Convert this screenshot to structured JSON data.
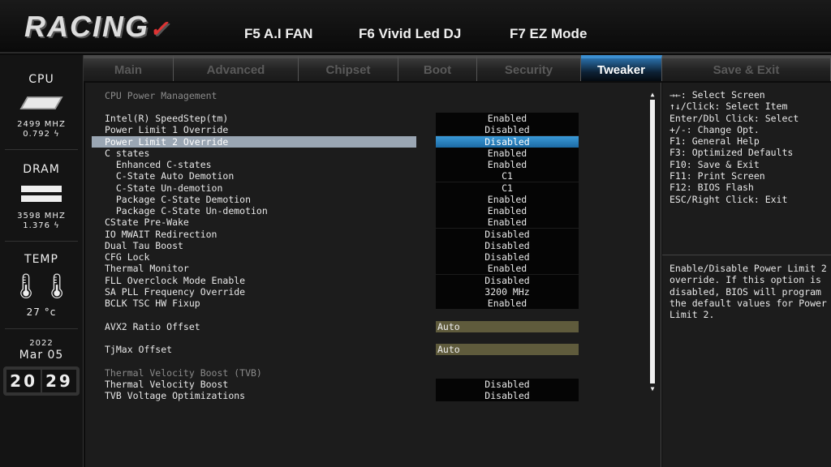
{
  "header": {
    "logo": "RACING",
    "hotkeys": [
      "F5 A.I FAN",
      "F6 Vivid Led DJ",
      "F7 EZ Mode"
    ]
  },
  "sidebar": {
    "cpu": {
      "label": "CPU",
      "freq": "2499 MHZ",
      "volt": "0.792 ϟ"
    },
    "dram": {
      "label": "DRAM",
      "freq": "3598 MHZ",
      "volt": "1.376 ϟ"
    },
    "temp": {
      "label": "TEMP",
      "value": "27 °c"
    },
    "date": {
      "year": "2022",
      "day": "Mar 05"
    },
    "clock": {
      "hours": "20",
      "minutes": "29"
    }
  },
  "tabs": [
    "Main",
    "Advanced",
    "Chipset",
    "Boot",
    "Security",
    "Tweaker",
    "Save & Exit"
  ],
  "active_tab": "Tweaker",
  "main": {
    "section1": "CPU Power Management",
    "items": [
      {
        "label": "Intel(R) SpeedStep(tm)",
        "value": "Enabled"
      },
      {
        "label": "Power Limit 1 Override",
        "value": "Disabled"
      },
      {
        "label": "Power Limit 2 Override",
        "value": "Disabled"
      },
      {
        "label": "C states",
        "value": "Enabled"
      },
      {
        "label": "  Enhanced C-states",
        "value": "Enabled"
      },
      {
        "label": "  C-State Auto Demotion",
        "value": "C1"
      },
      {
        "label": "  C-State Un-demotion",
        "value": "C1"
      },
      {
        "label": "  Package C-State Demotion",
        "value": "Enabled"
      },
      {
        "label": "  Package C-State Un-demotion",
        "value": "Enabled"
      },
      {
        "label": "CState Pre-Wake",
        "value": "Enabled"
      },
      {
        "label": "IO MWAIT Redirection",
        "value": "Disabled"
      },
      {
        "label": "Dual Tau Boost",
        "value": "Disabled"
      },
      {
        "label": "CFG Lock",
        "value": "Disabled"
      },
      {
        "label": "Thermal Monitor",
        "value": "Enabled"
      },
      {
        "label": "FLL Overclock Mode Enable",
        "value": "Disabled"
      },
      {
        "label": "SA PLL Frequency Override",
        "value": "3200 MHz"
      },
      {
        "label": "BCLK TSC HW Fixup",
        "value": "Enabled"
      }
    ],
    "avx2": {
      "label": "AVX2 Ratio Offset",
      "value": "Auto"
    },
    "tjmax": {
      "label": "TjMax Offset",
      "value": "Auto"
    },
    "section2": "Thermal Velocity Boost (TVB)",
    "tvb": [
      {
        "label": "Thermal Velocity Boost",
        "value": "Disabled"
      },
      {
        "label": "TVB Voltage Optimizations",
        "value": "Disabled"
      }
    ]
  },
  "help": "→←: Select Screen\n↑↓/Click: Select Item\nEnter/Dbl Click: Select\n+/-: Change Opt.\nF1: General Help\nF3: Optimized Defaults\nF10: Save & Exit\nF11: Print Screen\nF12: BIOS Flash\nESC/Right Click: Exit",
  "description": "Enable/Disable Power Limit 2 override. If this option is disabled, BIOS will program the default values for Power Limit 2."
}
